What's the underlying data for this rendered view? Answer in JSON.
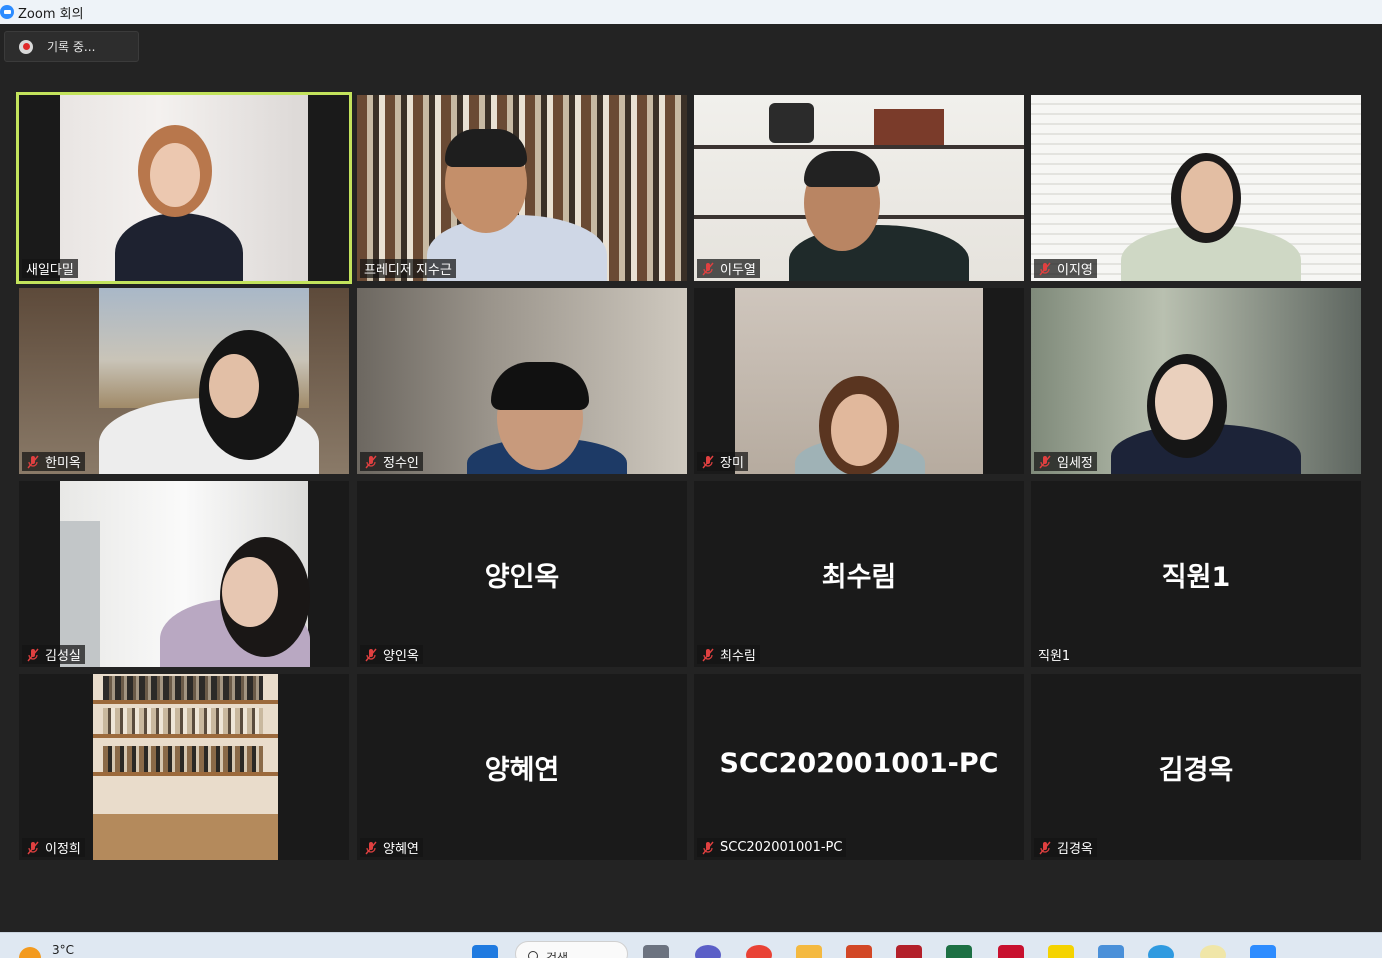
{
  "window": {
    "title": "Zoom 회의"
  },
  "recording": {
    "label": "기록 중..."
  },
  "participants": [
    {
      "name": "새일다밀",
      "muted": false,
      "video": true,
      "active": true
    },
    {
      "name": "프레디저 지수근",
      "muted": false,
      "video": true,
      "active": false
    },
    {
      "name": "이두열",
      "muted": true,
      "video": true,
      "active": false
    },
    {
      "name": "이지영",
      "muted": true,
      "video": true,
      "active": false
    },
    {
      "name": "한미옥",
      "muted": true,
      "video": true,
      "active": false
    },
    {
      "name": "정수인",
      "muted": true,
      "video": true,
      "active": false
    },
    {
      "name": "장미",
      "muted": true,
      "video": true,
      "active": false
    },
    {
      "name": "임세정",
      "muted": true,
      "video": true,
      "active": false
    },
    {
      "name": "김성실",
      "muted": true,
      "video": true,
      "active": false
    },
    {
      "name": "양인옥",
      "muted": true,
      "video": false,
      "active": false
    },
    {
      "name": "최수림",
      "muted": true,
      "video": false,
      "active": false
    },
    {
      "name": "직원1",
      "muted": false,
      "video": false,
      "active": false
    },
    {
      "name": "이정희",
      "muted": true,
      "video": true,
      "active": false
    },
    {
      "name": "양혜연",
      "muted": true,
      "video": false,
      "active": false
    },
    {
      "name": "SCC202001001-PC",
      "muted": true,
      "video": false,
      "active": false
    },
    {
      "name": "김경옥",
      "muted": true,
      "video": false,
      "active": false
    }
  ],
  "taskbar": {
    "temperature": "3°C",
    "search_label": "검색"
  },
  "colors": {
    "active_speaker_border": "#c3e35c",
    "muted_icon": "#e04040",
    "zoom_brand": "#2d8cff"
  }
}
